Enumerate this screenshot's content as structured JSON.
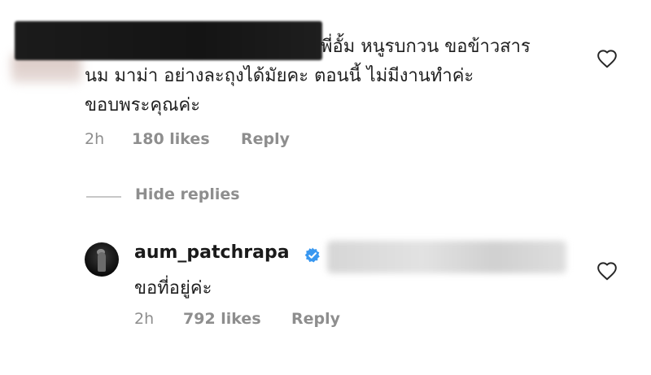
{
  "comment": {
    "lines": [
      "พี่อั้ม หนูรบกวน ขอข้าวสาร",
      "นม มาม่า อย่างละถุงได้มัยคะ ตอนนี้ ไม่มีงานทำค่ะ",
      "ขอบพระคุณค่ะ"
    ],
    "time": "2h",
    "likes": "180 likes",
    "reply_label": "Reply"
  },
  "hide_replies_label": "Hide replies",
  "reply": {
    "username": "aum_patchrapa",
    "text": "ขอที่อยู่ค่ะ",
    "time": "2h",
    "likes": "792 likes",
    "reply_label": "Reply"
  },
  "icons": {
    "heart": "heart-outline-icon",
    "verified": "verified-badge-icon"
  },
  "colors": {
    "meta_gray": "#8e8e8e",
    "verified_blue": "#3897f0"
  }
}
